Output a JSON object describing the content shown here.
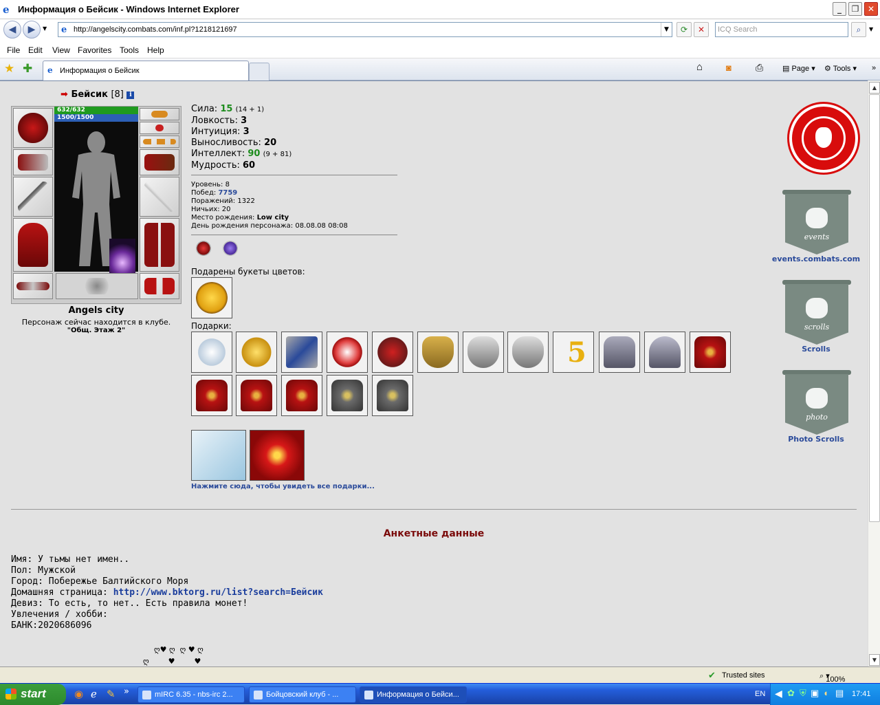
{
  "window": {
    "title": "Информация о Бейсик - Windows Internet Explorer"
  },
  "address": {
    "url": "http://angelscity.combats.com/inf.pl?1218121697",
    "search_placeholder": "ICQ Search"
  },
  "menu": [
    "File",
    "Edit",
    "View",
    "Favorites",
    "Tools",
    "Help"
  ],
  "tab": {
    "label": "Информация о Бейсик"
  },
  "toolbar": {
    "page": "Page",
    "tools": "Tools"
  },
  "character": {
    "name": "Бейсик",
    "level": "[8]",
    "info_icon": "i",
    "hp": "632/632",
    "mana": "1500/1500",
    "city": "Angels city",
    "location": "Персонаж сейчас находится в клубе.",
    "room": "\"Общ. Этаж 2\""
  },
  "stats": [
    {
      "label": "Сила:",
      "value": "15",
      "extra": "(14 + 1)",
      "green": true
    },
    {
      "label": "Ловкость:",
      "value": "3",
      "extra": "",
      "green": false
    },
    {
      "label": "Интуиция:",
      "value": "3",
      "extra": "",
      "green": false
    },
    {
      "label": "Выносливость:",
      "value": "20",
      "extra": "",
      "green": false
    },
    {
      "label": "Интеллект:",
      "value": "90",
      "extra": "(9 + 81)",
      "green": true
    },
    {
      "label": "Мудрость:",
      "value": "60",
      "extra": "",
      "green": false
    }
  ],
  "record": [
    {
      "label": "Уровень:",
      "value": "8",
      "blue": false
    },
    {
      "label": "Побед:",
      "value": "7759",
      "blue": true
    },
    {
      "label": "Поражений:",
      "value": "1322",
      "blue": false
    },
    {
      "label": "Ничьих:",
      "value": "20",
      "blue": false
    },
    {
      "label": "Место рождения:",
      "value": "Low city",
      "blue": false,
      "bold": true
    },
    {
      "label": "День рождения персонажа:",
      "value": "08.08.08 08:08",
      "blue": false
    }
  ],
  "flowers_label": "Подарены букеты цветов:",
  "gifts_label": "Подарки:",
  "all_gifts_link": "Нажмите сюда, чтобы увидеть все подарки...",
  "sidebar": [
    {
      "label": "events.combats.com",
      "banner": "events"
    },
    {
      "label": "Scrolls",
      "banner": "scrolls"
    },
    {
      "label": "Photo Scrolls",
      "banner": "photo"
    }
  ],
  "anketa": {
    "title": "Анкетные данные",
    "name_label": "Имя:",
    "name": "У тьмы нет имен..",
    "sex_label": "Пол:",
    "sex": "Мужской",
    "city_label": "Город:",
    "city": "Побережье Балтийского Моря",
    "home_label": "Домашняя страница:",
    "home": "http://www.bktorg.ru/list?search=Бейсик",
    "motto_label": "Девиз:",
    "motto": "То есть, то нет.. Есть правила монет!",
    "hobby_label": "Увлечения / хобби:",
    "bank": "БАНК:2020686096",
    "hearts_line1": "ღ♥ ღ  ღ ♥ ღ",
    "hearts_line2": "ღ        ♥        ♥"
  },
  "status": {
    "zone": "Trusted sites",
    "zoom": "100%"
  },
  "taskbar": {
    "start": "start",
    "items": [
      "mIRC 6.35 - nbs-irc 2...",
      "Бойцовский клуб - ...",
      "Информация о Бейси..."
    ],
    "lang": "EN",
    "clock": "17:41"
  },
  "colors": {
    "hp": "#1f9a1f",
    "mana": "#2c5fb5",
    "anketa_title": "#7a0a0a",
    "link": "#1a3d9c"
  }
}
